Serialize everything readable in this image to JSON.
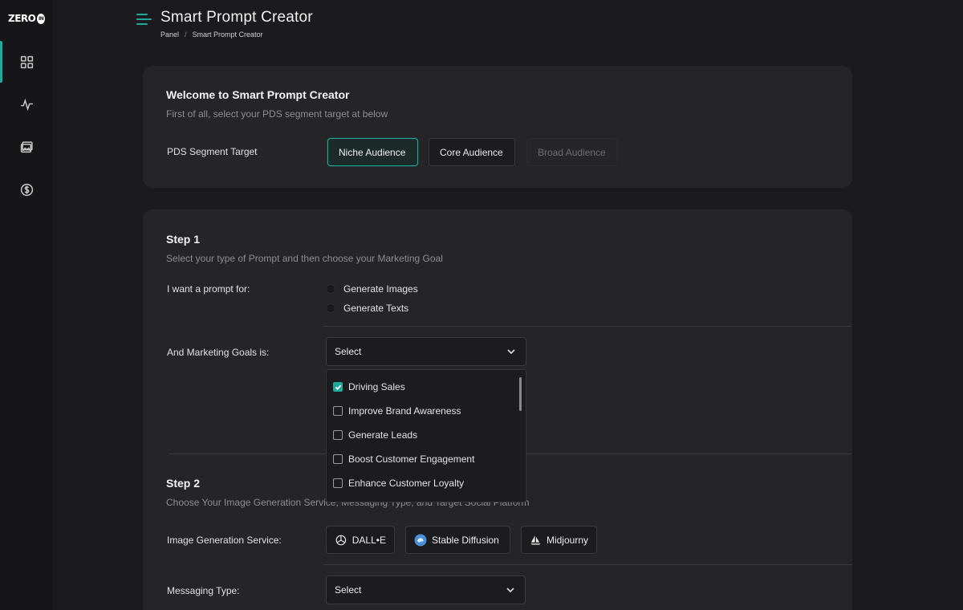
{
  "brand": {
    "logo_text": "ZERO",
    "logo_badge": "IN"
  },
  "header": {
    "title": "Smart Prompt Creator",
    "breadcrumb": [
      "Panel",
      "Smart Prompt Creator"
    ],
    "breadcrumb_sep": "/"
  },
  "sidebar": {
    "items": [
      {
        "icon": "grid-icon",
        "active": true
      },
      {
        "icon": "activity-icon",
        "active": false
      },
      {
        "icon": "images-icon",
        "active": false
      },
      {
        "icon": "dollar-icon",
        "active": false
      }
    ]
  },
  "welcome": {
    "title": "Welcome to Smart Prompt Creator",
    "subtitle": "First of all, select your PDS segment target at below",
    "segment_label": "PDS Segment Target",
    "segments": [
      {
        "label": "Niche Audience",
        "state": "selected"
      },
      {
        "label": "Core Audience",
        "state": "normal"
      },
      {
        "label": "Broad Audience",
        "state": "disabled"
      }
    ]
  },
  "step1": {
    "title": "Step 1",
    "subtitle": "Select your type of Prompt and then choose your Marketing Goal",
    "prompt_label": "I want a prompt for:",
    "prompt_options": [
      "Generate Images",
      "Generate Texts"
    ],
    "goals_label": "And Marketing Goals is:",
    "goals_select_value": "Select",
    "goals_options": [
      {
        "label": "Driving Sales",
        "checked": true
      },
      {
        "label": "Improve Brand Awareness",
        "checked": false
      },
      {
        "label": "Generate Leads",
        "checked": false
      },
      {
        "label": "Boost Customer Engagement",
        "checked": false
      },
      {
        "label": "Enhance Customer Loyalty",
        "checked": false
      }
    ]
  },
  "step2": {
    "title": "Step 2",
    "subtitle": "Choose Your Image Generation Service, Messaging Type, and Target Social Platform",
    "service_label": "Image Generation Service:",
    "services": [
      "DALL•E",
      "Stable Diffusion",
      "Midjourny"
    ],
    "messaging_label": "Messaging Type:",
    "messaging_select_value": "Select"
  },
  "colors": {
    "accent": "#1fa99a",
    "background": "#1b1b1d",
    "card": "#252528"
  }
}
